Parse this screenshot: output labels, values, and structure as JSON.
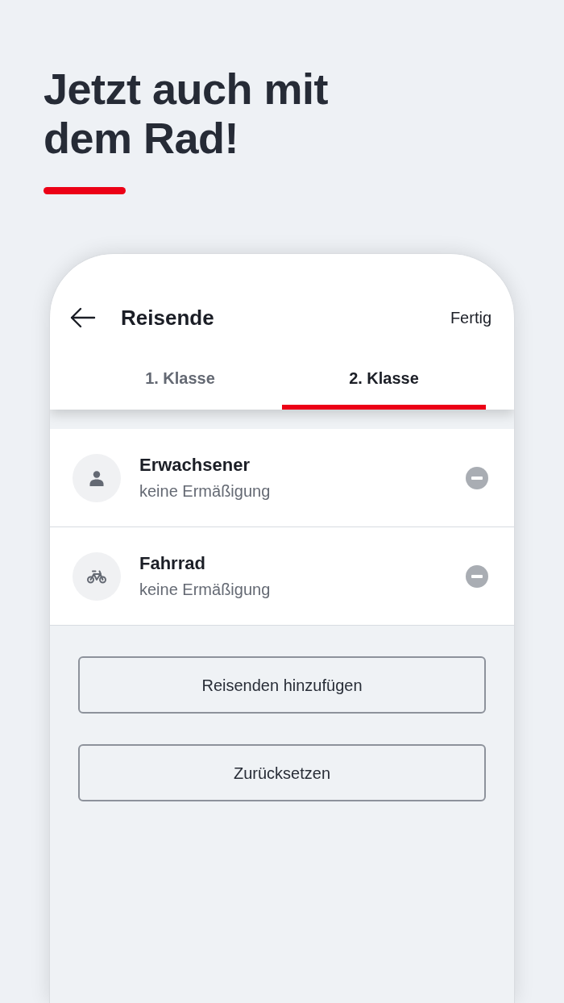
{
  "headline": "Jetzt auch mit dem Rad!",
  "screen": {
    "header": {
      "title": "Reisende",
      "done_button": "Fertig"
    },
    "tabs": [
      {
        "label": "1. Klasse",
        "selected": false
      },
      {
        "label": "2. Klasse",
        "selected": true
      }
    ],
    "travelers": [
      {
        "kind": "person",
        "name": "Erwachsener",
        "discount": "keine Ermäßigung"
      },
      {
        "kind": "bicycle",
        "name": "Fahrrad",
        "discount": "keine Ermäßigung"
      }
    ],
    "buttons": [
      "Reisenden hinzufügen",
      "Zurücksetzen"
    ]
  }
}
